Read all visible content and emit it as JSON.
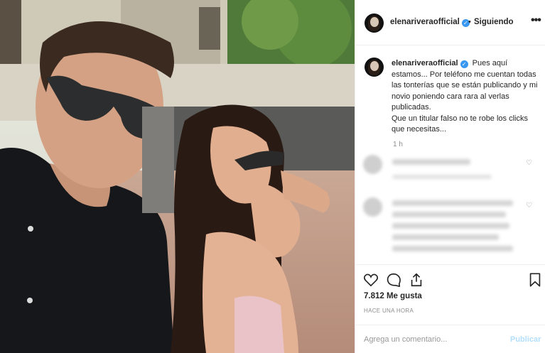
{
  "post": {
    "username": "elenariveraofficial",
    "verified_icon": "verified-badge-icon",
    "follow_separator": "•",
    "follow_status": "Siguiendo",
    "more_label": "•••",
    "caption": "Pues aquí estamos... Por teléfono me cuentan todas las tonterías que se están publicando y mi novio poniendo cara rara al verlas publicadas.\nQue un titular falso no te robe los clicks que necesitas...",
    "caption_time": "1 h",
    "likes": "7.812 Me gusta",
    "posted_ago": "HACE UNA HORA",
    "comment_placeholder": "Agrega un comentario...",
    "publish_label": "Publicar"
  },
  "icons": {
    "like": "heart-icon",
    "comment": "comment-icon",
    "share": "share-icon",
    "save": "bookmark-icon",
    "comment_like": "small-heart-icon"
  },
  "colors": {
    "accent_blue": "#3897f0",
    "publish_disabled": "#b2dffc",
    "secondary_text": "#8e8e8e"
  }
}
